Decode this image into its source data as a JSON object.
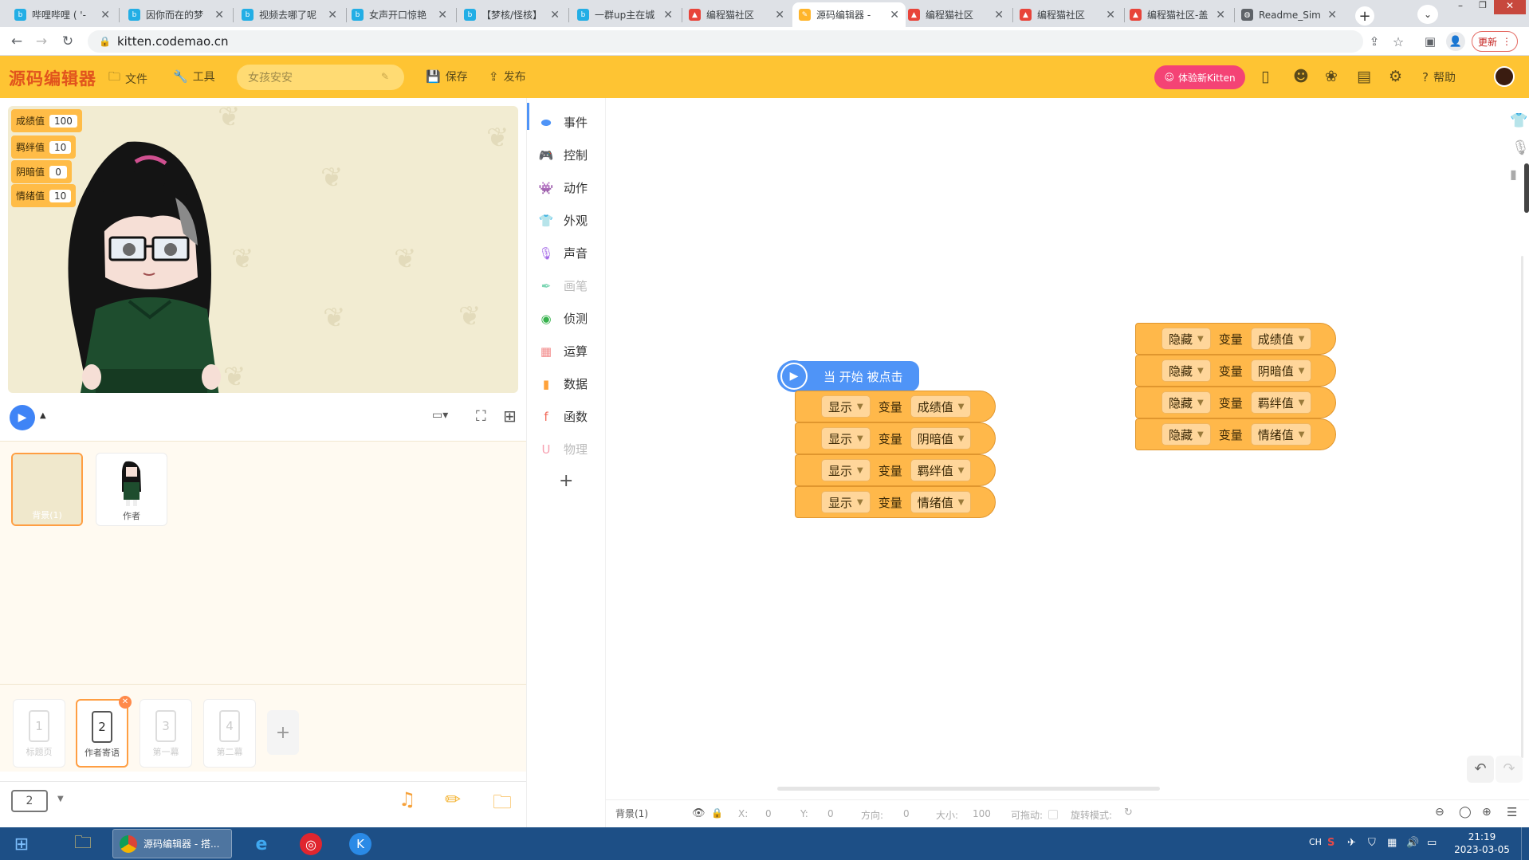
{
  "browser": {
    "tabs": [
      {
        "title": "哔哩哔哩 ( '- ",
        "color": "#23aee5",
        "glyph": "b"
      },
      {
        "title": "因你而在的梦",
        "color": "#23aee5",
        "glyph": "b"
      },
      {
        "title": "视频去哪了呢",
        "color": "#23aee5",
        "glyph": "b"
      },
      {
        "title": "女声开口惊艳",
        "color": "#23aee5",
        "glyph": "b"
      },
      {
        "title": "【梦核/怪核】",
        "color": "#23aee5",
        "glyph": "b"
      },
      {
        "title": "一群up主在城",
        "color": "#23aee5",
        "glyph": "b"
      },
      {
        "title": "编程猫社区",
        "color": "#e8443a",
        "glyph": "▲"
      },
      {
        "title": "源码编辑器 - ",
        "color": "#ffb52b",
        "glyph": "✎"
      },
      {
        "title": "编程猫社区",
        "color": "#e8443a",
        "glyph": "▲"
      },
      {
        "title": "编程猫社区",
        "color": "#e8443a",
        "glyph": "▲"
      },
      {
        "title": "编程猫社区-盖",
        "color": "#e8443a",
        "glyph": "▲"
      },
      {
        "title": "Readme_Sim",
        "color": "#5f6368",
        "glyph": "◍"
      }
    ],
    "url": "kitten.codemao.cn",
    "update_label": "更新"
  },
  "app": {
    "logo": "源码编辑器",
    "file_label": "文件",
    "tools_label": "工具",
    "work_title": "女孩安安",
    "save_label": "保存",
    "publish_label": "发布",
    "try_kitten_label": "体验新Kitten",
    "help_label": "帮助"
  },
  "variables": [
    {
      "name": "成绩值",
      "value": "100"
    },
    {
      "name": "羁绊值",
      "value": "10"
    },
    {
      "name": "阴暗值",
      "value": "0"
    },
    {
      "name": "情绪值",
      "value": "10"
    }
  ],
  "sprites": [
    {
      "label": "背景(1)"
    },
    {
      "label": "作者"
    }
  ],
  "scenes": [
    {
      "number": "1",
      "label": "标题页"
    },
    {
      "number": "2",
      "label": "作者寄语"
    },
    {
      "number": "3",
      "label": "第一幕"
    },
    {
      "number": "4",
      "label": "第二幕"
    }
  ],
  "screen_count": "2",
  "categories": [
    {
      "label": "事件",
      "icon": "toggle-icon",
      "color": "#4f94f7",
      "glyph": "⬬"
    },
    {
      "label": "控制",
      "icon": "gamepad-icon",
      "color": "#47a8f5",
      "glyph": "🎮"
    },
    {
      "label": "动作",
      "icon": "ghost-icon",
      "color": "#f25b5b",
      "glyph": "👾"
    },
    {
      "label": "外观",
      "icon": "shirt-icon",
      "color": "#d468e0",
      "glyph": "👕"
    },
    {
      "label": "声音",
      "icon": "mic-icon",
      "color": "#a56be8",
      "glyph": "🎙"
    },
    {
      "label": "画笔",
      "icon": "pen-icon",
      "color": "#7ed6b4",
      "glyph": "✒"
    },
    {
      "label": "侦测",
      "icon": "detect-icon",
      "color": "#37b24d",
      "glyph": "◉"
    },
    {
      "label": "运算",
      "icon": "calc-icon",
      "color": "#f28a8a",
      "glyph": "▦"
    },
    {
      "label": "数据",
      "icon": "chart-icon",
      "color": "#ffa23a",
      "glyph": "▮"
    },
    {
      "label": "函数",
      "icon": "function-icon",
      "color": "#f26b5b",
      "glyph": "f"
    },
    {
      "label": "物理",
      "icon": "magnet-icon",
      "color": "#f7a0b0",
      "glyph": "U"
    }
  ],
  "script1": {
    "hat": "当 开始 被点击",
    "blocks": [
      {
        "action": "显示",
        "kw": "变量",
        "var": "成绩值"
      },
      {
        "action": "显示",
        "kw": "变量",
        "var": "阴暗值"
      },
      {
        "action": "显示",
        "kw": "变量",
        "var": "羁绊值"
      },
      {
        "action": "显示",
        "kw": "变量",
        "var": "情绪值"
      }
    ]
  },
  "script2": {
    "blocks": [
      {
        "action": "隐藏",
        "kw": "变量",
        "var": "成绩值"
      },
      {
        "action": "隐藏",
        "kw": "变量",
        "var": "阴暗值"
      },
      {
        "action": "隐藏",
        "kw": "变量",
        "var": "羁绊值"
      },
      {
        "action": "隐藏",
        "kw": "变量",
        "var": "情绪值"
      }
    ]
  },
  "props": {
    "name": "背景(1)",
    "x_label": "X:",
    "x": "0",
    "y_label": "Y:",
    "y": "0",
    "dir_label": "方向:",
    "dir": "0",
    "size_label": "大小:",
    "size": "100",
    "drag_label": "可拖动:",
    "rot_label": "旋转模式:"
  },
  "taskbar": {
    "chrome_label": "源码编辑器 - 搭...",
    "ime": "CH",
    "time": "21:19",
    "date": "2023-03-05"
  }
}
